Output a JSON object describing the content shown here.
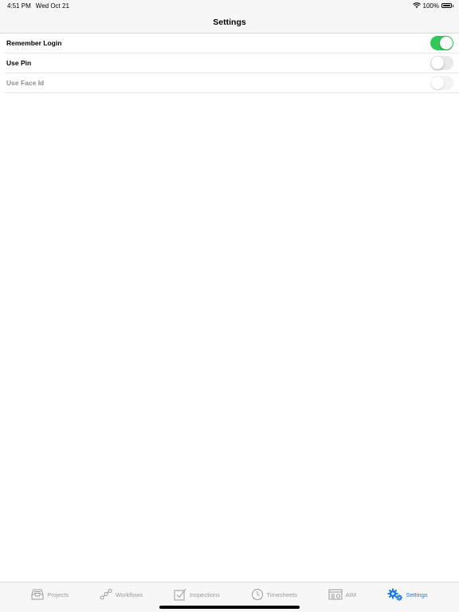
{
  "status": {
    "time": "4:51 PM",
    "date": "Wed Oct 21",
    "battery": "100%",
    "battery_level": 1.0,
    "icons": [
      "wifi-icon",
      "battery-icon"
    ]
  },
  "nav": {
    "title": "Settings"
  },
  "settings": [
    {
      "label": "Remember Login",
      "on": true,
      "enabled": true
    },
    {
      "label": "Use Pin",
      "on": false,
      "enabled": true
    },
    {
      "label": "Use Face Id",
      "on": false,
      "enabled": false
    }
  ],
  "tabs": [
    {
      "label": "Projects",
      "icon": "inbox-icon",
      "active": false
    },
    {
      "label": "Workflows",
      "icon": "workflow-icon",
      "active": false
    },
    {
      "label": "Inspections",
      "icon": "checkbox-icon",
      "active": false
    },
    {
      "label": "Timesheets",
      "icon": "clock-icon",
      "active": false
    },
    {
      "label": "AIM",
      "icon": "aim-icon",
      "active": false
    },
    {
      "label": "Settings",
      "icon": "gears-icon",
      "active": true
    }
  ],
  "colors": {
    "accent": "#1b7ae6",
    "toggle_on": "#34c759",
    "toggle_off": "#e9e9eb",
    "inactive_tab": "#9b9b9b"
  }
}
